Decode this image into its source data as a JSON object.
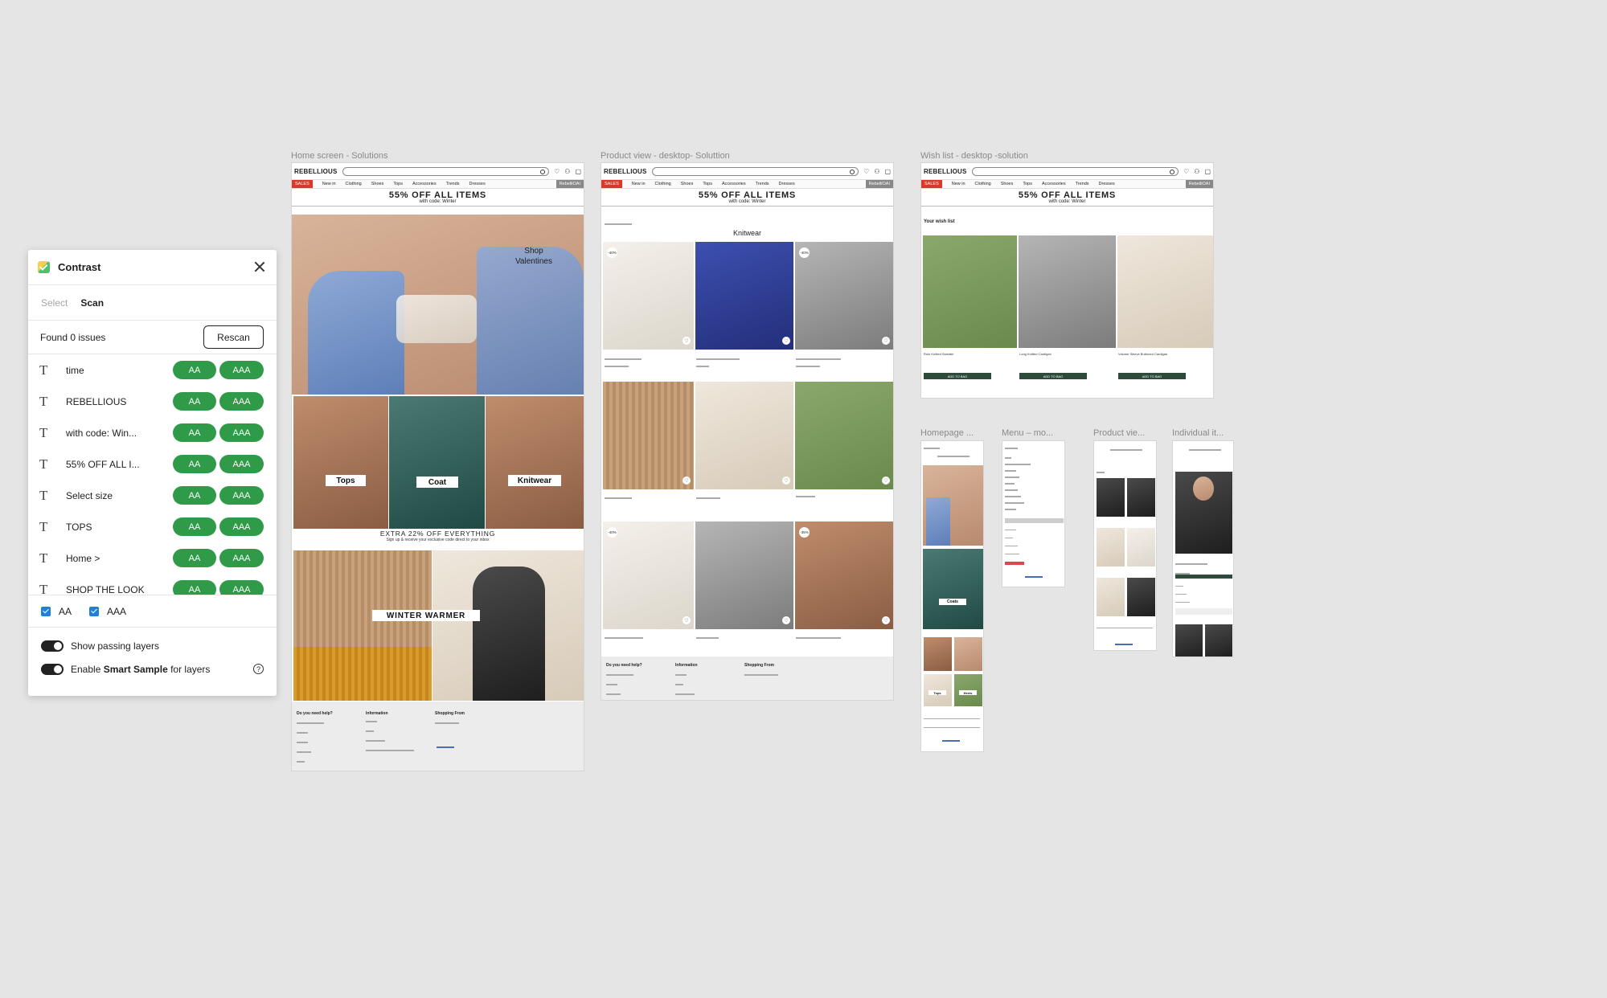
{
  "panel": {
    "title": "Contrast",
    "tab_select": "Select",
    "tab_scan": "Scan",
    "found": "Found 0 issues",
    "rescan": "Rescan",
    "layers": [
      {
        "name": "time",
        "aa": "AA",
        "aaa": "AAA"
      },
      {
        "name": "REBELLIOUS",
        "aa": "AA",
        "aaa": "AAA"
      },
      {
        "name": "with code: Win...",
        "aa": "AA",
        "aaa": "AAA"
      },
      {
        "name": "55% OFF ALL I...",
        "aa": "AA",
        "aaa": "AAA"
      },
      {
        "name": "Select size",
        "aa": "AA",
        "aaa": "AAA"
      },
      {
        "name": "TOPS",
        "aa": "AA",
        "aaa": "AAA"
      },
      {
        "name": "Home >",
        "aa": "AA",
        "aaa": "AAA"
      },
      {
        "name": "SHOP THE LOOK",
        "aa": "AA",
        "aaa": "AAA"
      }
    ],
    "check_aa": "AA",
    "check_aaa": "AAA",
    "toggle_passing": "Show passing layers",
    "toggle_smart_pre": "Enable ",
    "toggle_smart_bold": "Smart Sample",
    "toggle_smart_post": " for layers",
    "help": "?"
  },
  "frames": {
    "home_label": "Home screen - Solutions",
    "product_label": "Product view - desktop- Soluttion",
    "wish_label": "Wish list - desktop -solution",
    "homepage_m_label": "Homepage ...",
    "menu_m_label": "Menu – mo...",
    "product_m_label": "Product vie...",
    "individual_m_label": "Individual it..."
  },
  "site": {
    "logo": "REBELLIOUS",
    "sales": "SALES",
    "nav": [
      "New in",
      "Clothing",
      "Shoes",
      "Tops",
      "Accessories",
      "Trends",
      "Dresses"
    ],
    "rebel": "RebelliOAI",
    "promo_big": "55% OFF ALL ITEMS",
    "promo_small": "with code: Winter",
    "footer_help": "Do you need help?",
    "footer_info": "Information",
    "footer_shop": "Shopping From"
  },
  "home": {
    "hero_text": "Shop\nValentines",
    "tops": "Tops",
    "coat": "Coat",
    "knitwear": "Knitwear",
    "extra": "EXTRA 22% OFF EVERYTHING",
    "extra_sub": "Sign up & receive your exclusive code direct to your inbox",
    "winter": "WINTER WARMER"
  },
  "product": {
    "heading": "Knitwear",
    "badges": [
      "-40%",
      "-40%",
      "-40%",
      "-35%"
    ]
  },
  "wish": {
    "title": "Your wish list",
    "add": "ADD TO BAG",
    "items": [
      "Rolo Knitted Sweater",
      "Long Knitted Cardigan",
      "Volume Sleeve Buttoned Cardigan"
    ]
  },
  "mobile": {
    "coats": "Coats",
    "tops": "Tops",
    "heels": "Heels",
    "shop_valentines": "Shop Valentines"
  }
}
